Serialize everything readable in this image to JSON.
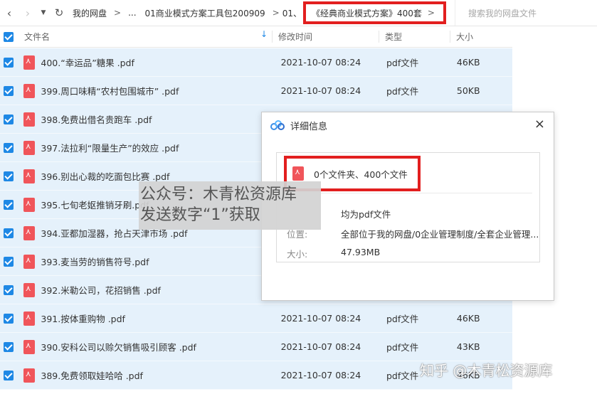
{
  "breadcrumb": {
    "root": "我的网盘",
    "ellipsis": "...",
    "parent": "01商业模式方案工具包200909",
    "prefix": "01、",
    "current": "《经典商业模式方案》400套",
    "separator": ">"
  },
  "search": {
    "placeholder": "搜索我的网盘文件"
  },
  "columns": {
    "name": "文件名",
    "time": "修改时间",
    "type": "类型",
    "size": "大小",
    "sort_arrow": "↓"
  },
  "files": [
    {
      "name": "400.“幸运品”糖果 .pdf",
      "time": "2021-10-07 08:24",
      "type": "pdf文件",
      "size": "46KB"
    },
    {
      "name": "399.周口味精“农村包围城市” .pdf",
      "time": "2021-10-07 08:24",
      "type": "pdf文件",
      "size": "50KB"
    },
    {
      "name": "398.免费出借名贵跑车 .pdf",
      "time": "",
      "type": "",
      "size": ""
    },
    {
      "name": "397.法拉利“限量生产”的效应 .pdf",
      "time": "",
      "type": "",
      "size": ""
    },
    {
      "name": "396.别出心裁的吃面包比赛 .pdf",
      "time": "",
      "type": "",
      "size": ""
    },
    {
      "name": "395.七旬老妪推销牙刷.pdf",
      "time": "",
      "type": "",
      "size": ""
    },
    {
      "name": "394.亚都加湿器，抢占天津市场 .pdf",
      "time": "",
      "type": "",
      "size": ""
    },
    {
      "name": "393.麦当劳的销售符号.pdf",
      "time": "",
      "type": "",
      "size": ""
    },
    {
      "name": "392.米勒公司，花招销售 .pdf",
      "time": "",
      "type": "",
      "size": ""
    },
    {
      "name": "391.按体重购物 .pdf",
      "time": "2021-10-07 08:24",
      "type": "pdf文件",
      "size": "46KB"
    },
    {
      "name": "390.安科公司以赊欠销售吸引顾客 .pdf",
      "time": "2021-10-07 08:24",
      "type": "pdf文件",
      "size": "43KB"
    },
    {
      "name": "389.免费领取娃哈哈 .pdf",
      "time": "2021-10-07 08:24",
      "type": "pdf文件",
      "size": "46KB"
    }
  ],
  "dialog": {
    "title": "详细信息",
    "close": "×",
    "summary": "0个文件夹、400个文件",
    "type_value": "均为pdf文件",
    "location_label": "位置:",
    "location_value": "全部位于我的网盘/0企业管理制度/全套企业管理...",
    "size_label": "大小:",
    "size_value": "47.93MB"
  },
  "watermark": {
    "line1": "公众号：木青松资源库",
    "line2": "发送数字“1”获取"
  },
  "zhihu_watermark": "知乎 @木青松资源库",
  "colors": {
    "accent": "#1e88e5",
    "row_bg": "#e5f1fb",
    "highlight": "#e21f1f",
    "pdf": "#f0555a"
  }
}
